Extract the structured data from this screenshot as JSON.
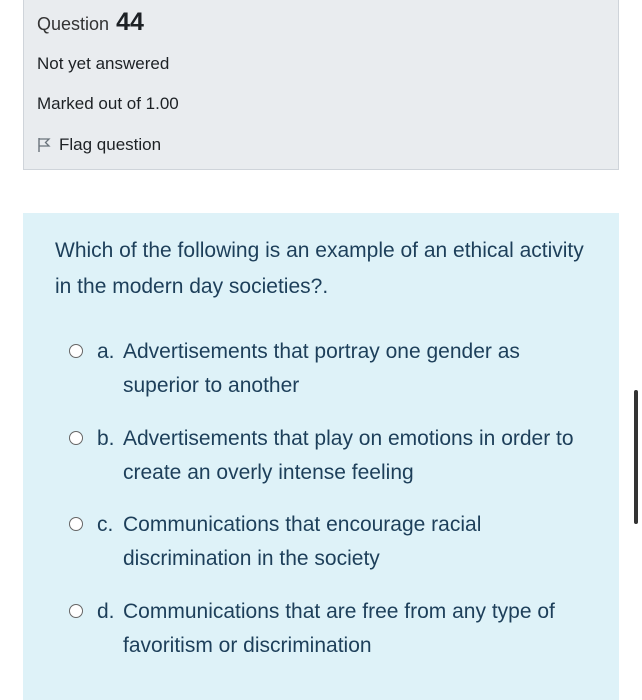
{
  "question": {
    "label": "Question",
    "number": "44",
    "status": "Not yet answered",
    "marked_out_of": "Marked out of 1.00",
    "flag_label": "Flag question",
    "text": "Which of the following is an example of an ethical activity in the modern day societies?."
  },
  "answers": [
    {
      "letter": "a.",
      "text": "Advertisements that portray one gender as superior to another"
    },
    {
      "letter": "b.",
      "text": "Advertisements that play on emotions in order to create an overly intense feeling"
    },
    {
      "letter": "c.",
      "text": "Communications that encourage racial discrimination in the society"
    },
    {
      "letter": "d.",
      "text": "Communications that are free from any type of favoritism or discrimination"
    }
  ],
  "colors": {
    "info_background": "#e9ecef",
    "content_background": "#def2f8",
    "text": "#1d3f5a"
  }
}
